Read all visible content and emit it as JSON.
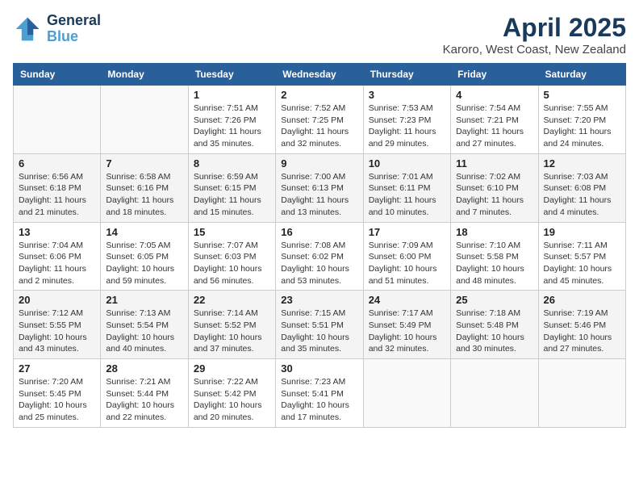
{
  "header": {
    "logo_line1": "General",
    "logo_line2": "Blue",
    "month_title": "April 2025",
    "location": "Karoro, West Coast, New Zealand"
  },
  "weekdays": [
    "Sunday",
    "Monday",
    "Tuesday",
    "Wednesday",
    "Thursday",
    "Friday",
    "Saturday"
  ],
  "weeks": [
    [
      {
        "day": "",
        "sunrise": "",
        "sunset": "",
        "daylight": ""
      },
      {
        "day": "",
        "sunrise": "",
        "sunset": "",
        "daylight": ""
      },
      {
        "day": "1",
        "sunrise": "Sunrise: 7:51 AM",
        "sunset": "Sunset: 7:26 PM",
        "daylight": "Daylight: 11 hours and 35 minutes."
      },
      {
        "day": "2",
        "sunrise": "Sunrise: 7:52 AM",
        "sunset": "Sunset: 7:25 PM",
        "daylight": "Daylight: 11 hours and 32 minutes."
      },
      {
        "day": "3",
        "sunrise": "Sunrise: 7:53 AM",
        "sunset": "Sunset: 7:23 PM",
        "daylight": "Daylight: 11 hours and 29 minutes."
      },
      {
        "day": "4",
        "sunrise": "Sunrise: 7:54 AM",
        "sunset": "Sunset: 7:21 PM",
        "daylight": "Daylight: 11 hours and 27 minutes."
      },
      {
        "day": "5",
        "sunrise": "Sunrise: 7:55 AM",
        "sunset": "Sunset: 7:20 PM",
        "daylight": "Daylight: 11 hours and 24 minutes."
      }
    ],
    [
      {
        "day": "6",
        "sunrise": "Sunrise: 6:56 AM",
        "sunset": "Sunset: 6:18 PM",
        "daylight": "Daylight: 11 hours and 21 minutes."
      },
      {
        "day": "7",
        "sunrise": "Sunrise: 6:58 AM",
        "sunset": "Sunset: 6:16 PM",
        "daylight": "Daylight: 11 hours and 18 minutes."
      },
      {
        "day": "8",
        "sunrise": "Sunrise: 6:59 AM",
        "sunset": "Sunset: 6:15 PM",
        "daylight": "Daylight: 11 hours and 15 minutes."
      },
      {
        "day": "9",
        "sunrise": "Sunrise: 7:00 AM",
        "sunset": "Sunset: 6:13 PM",
        "daylight": "Daylight: 11 hours and 13 minutes."
      },
      {
        "day": "10",
        "sunrise": "Sunrise: 7:01 AM",
        "sunset": "Sunset: 6:11 PM",
        "daylight": "Daylight: 11 hours and 10 minutes."
      },
      {
        "day": "11",
        "sunrise": "Sunrise: 7:02 AM",
        "sunset": "Sunset: 6:10 PM",
        "daylight": "Daylight: 11 hours and 7 minutes."
      },
      {
        "day": "12",
        "sunrise": "Sunrise: 7:03 AM",
        "sunset": "Sunset: 6:08 PM",
        "daylight": "Daylight: 11 hours and 4 minutes."
      }
    ],
    [
      {
        "day": "13",
        "sunrise": "Sunrise: 7:04 AM",
        "sunset": "Sunset: 6:06 PM",
        "daylight": "Daylight: 11 hours and 2 minutes."
      },
      {
        "day": "14",
        "sunrise": "Sunrise: 7:05 AM",
        "sunset": "Sunset: 6:05 PM",
        "daylight": "Daylight: 10 hours and 59 minutes."
      },
      {
        "day": "15",
        "sunrise": "Sunrise: 7:07 AM",
        "sunset": "Sunset: 6:03 PM",
        "daylight": "Daylight: 10 hours and 56 minutes."
      },
      {
        "day": "16",
        "sunrise": "Sunrise: 7:08 AM",
        "sunset": "Sunset: 6:02 PM",
        "daylight": "Daylight: 10 hours and 53 minutes."
      },
      {
        "day": "17",
        "sunrise": "Sunrise: 7:09 AM",
        "sunset": "Sunset: 6:00 PM",
        "daylight": "Daylight: 10 hours and 51 minutes."
      },
      {
        "day": "18",
        "sunrise": "Sunrise: 7:10 AM",
        "sunset": "Sunset: 5:58 PM",
        "daylight": "Daylight: 10 hours and 48 minutes."
      },
      {
        "day": "19",
        "sunrise": "Sunrise: 7:11 AM",
        "sunset": "Sunset: 5:57 PM",
        "daylight": "Daylight: 10 hours and 45 minutes."
      }
    ],
    [
      {
        "day": "20",
        "sunrise": "Sunrise: 7:12 AM",
        "sunset": "Sunset: 5:55 PM",
        "daylight": "Daylight: 10 hours and 43 minutes."
      },
      {
        "day": "21",
        "sunrise": "Sunrise: 7:13 AM",
        "sunset": "Sunset: 5:54 PM",
        "daylight": "Daylight: 10 hours and 40 minutes."
      },
      {
        "day": "22",
        "sunrise": "Sunrise: 7:14 AM",
        "sunset": "Sunset: 5:52 PM",
        "daylight": "Daylight: 10 hours and 37 minutes."
      },
      {
        "day": "23",
        "sunrise": "Sunrise: 7:15 AM",
        "sunset": "Sunset: 5:51 PM",
        "daylight": "Daylight: 10 hours and 35 minutes."
      },
      {
        "day": "24",
        "sunrise": "Sunrise: 7:17 AM",
        "sunset": "Sunset: 5:49 PM",
        "daylight": "Daylight: 10 hours and 32 minutes."
      },
      {
        "day": "25",
        "sunrise": "Sunrise: 7:18 AM",
        "sunset": "Sunset: 5:48 PM",
        "daylight": "Daylight: 10 hours and 30 minutes."
      },
      {
        "day": "26",
        "sunrise": "Sunrise: 7:19 AM",
        "sunset": "Sunset: 5:46 PM",
        "daylight": "Daylight: 10 hours and 27 minutes."
      }
    ],
    [
      {
        "day": "27",
        "sunrise": "Sunrise: 7:20 AM",
        "sunset": "Sunset: 5:45 PM",
        "daylight": "Daylight: 10 hours and 25 minutes."
      },
      {
        "day": "28",
        "sunrise": "Sunrise: 7:21 AM",
        "sunset": "Sunset: 5:44 PM",
        "daylight": "Daylight: 10 hours and 22 minutes."
      },
      {
        "day": "29",
        "sunrise": "Sunrise: 7:22 AM",
        "sunset": "Sunset: 5:42 PM",
        "daylight": "Daylight: 10 hours and 20 minutes."
      },
      {
        "day": "30",
        "sunrise": "Sunrise: 7:23 AM",
        "sunset": "Sunset: 5:41 PM",
        "daylight": "Daylight: 10 hours and 17 minutes."
      },
      {
        "day": "",
        "sunrise": "",
        "sunset": "",
        "daylight": ""
      },
      {
        "day": "",
        "sunrise": "",
        "sunset": "",
        "daylight": ""
      },
      {
        "day": "",
        "sunrise": "",
        "sunset": "",
        "daylight": ""
      }
    ]
  ]
}
